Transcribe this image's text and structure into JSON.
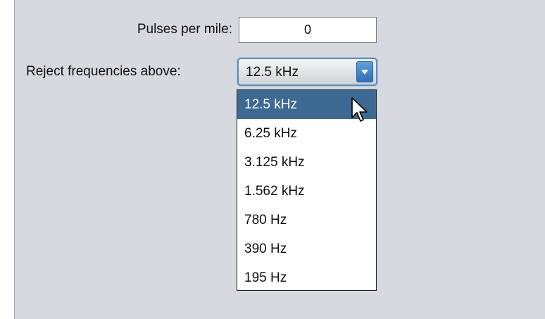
{
  "form": {
    "pulses_label": "Pulses per mile:",
    "pulses_value": "0",
    "reject_label": "Reject frequencies above:",
    "reject_selected": "12.5 kHz"
  },
  "dropdown": {
    "options": [
      "12.5 kHz",
      "6.25 kHz",
      "3.125 kHz",
      "1.562 kHz",
      "780 Hz",
      "390 Hz",
      "195 Hz"
    ],
    "selected_index": 0
  },
  "colors": {
    "panel_bg": "#d6d9df",
    "selected_bg": "#3d6a92",
    "combo_border": "#5a8ec0",
    "arrow_button": "#3f84cc"
  },
  "icons": {
    "dropdown_arrow": "chevron-down-icon",
    "cursor": "mouse-pointer-icon"
  }
}
